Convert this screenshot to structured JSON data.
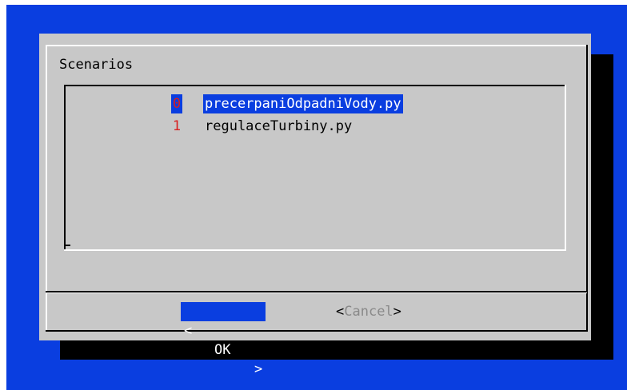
{
  "dialog": {
    "title": "Scenarios"
  },
  "list": {
    "items": [
      {
        "tag": "0",
        "label": "precerpaniOdpadniVody.py",
        "selected": true
      },
      {
        "tag": "1",
        "label": "regulaceTurbiny.py",
        "selected": false
      }
    ]
  },
  "buttons": {
    "ok": {
      "left": "<",
      "label": "OK",
      "right": ">"
    },
    "cancel": {
      "left": "<",
      "label": "Cancel",
      "right": ">"
    }
  },
  "colors": {
    "background": "#0a3ee0",
    "dialog": "#c8c8c8",
    "highlight": "#0a3ee0",
    "tag": "#d81e1e",
    "shadow": "#000000"
  }
}
